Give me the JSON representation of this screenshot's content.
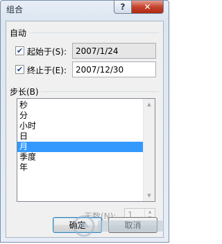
{
  "window": {
    "title": "组合",
    "help_icon": "?",
    "close_icon": "✕"
  },
  "auto_group": {
    "label": "自动",
    "start": {
      "label": "起始于(S):",
      "checked": true,
      "value": "2007/1/24"
    },
    "end": {
      "label": "终止于(E):",
      "checked": true,
      "value": "2007/12/30"
    }
  },
  "step": {
    "label": "步长(B)",
    "items": [
      {
        "label": "秒",
        "selected": false
      },
      {
        "label": "分",
        "selected": false
      },
      {
        "label": "小时",
        "selected": false
      },
      {
        "label": "日",
        "selected": false
      },
      {
        "label": "月",
        "selected": true
      },
      {
        "label": "季度",
        "selected": false
      },
      {
        "label": "年",
        "selected": false
      }
    ]
  },
  "days": {
    "label": "天数(N):",
    "value": "1",
    "enabled": false
  },
  "buttons": {
    "ok": "确定",
    "cancel": "取消"
  },
  "icons": {
    "check": "check-icon",
    "scroll_up": "scroll-up-arrow-icon",
    "scroll_down": "scroll-down-arrow-icon"
  },
  "colors": {
    "selection": "#3399ff",
    "close_button": "#c4432b"
  }
}
